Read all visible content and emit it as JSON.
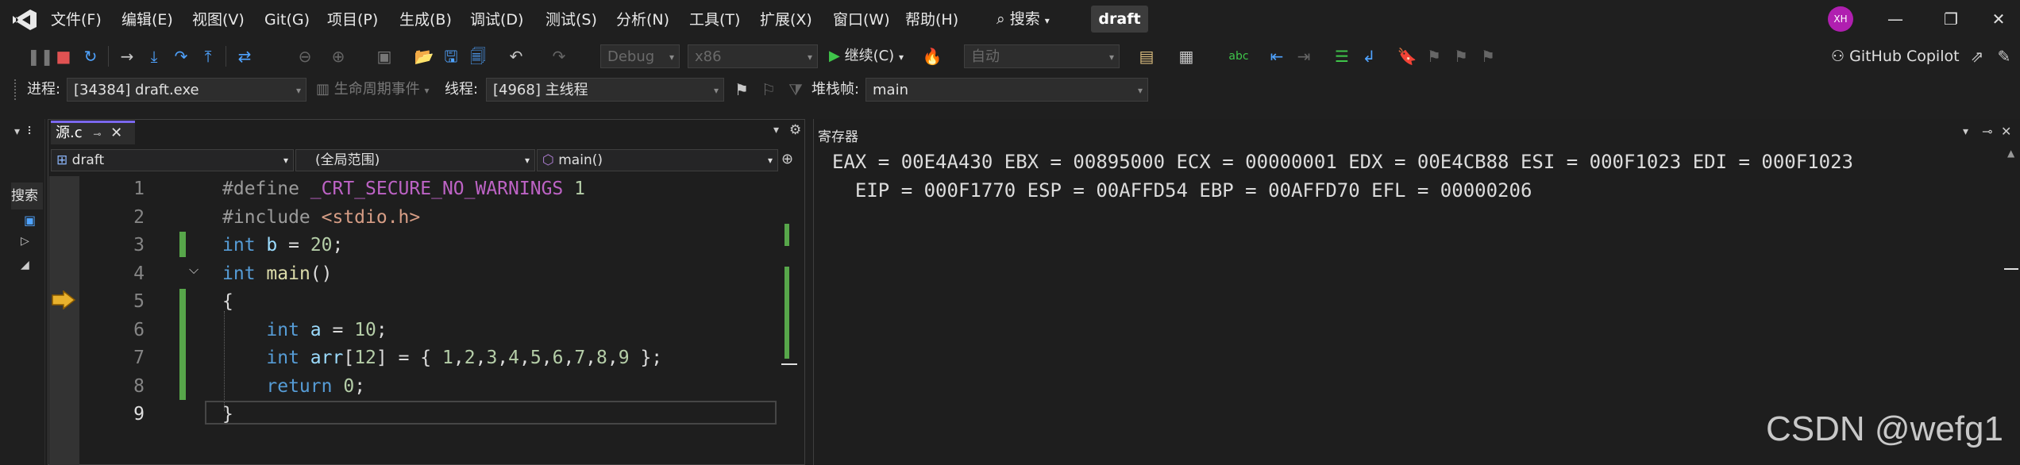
{
  "menu": [
    "文件(F)",
    "编辑(E)",
    "视图(V)",
    "Git(G)",
    "项目(P)",
    "生成(B)",
    "调试(D)",
    "测试(S)",
    "分析(N)",
    "工具(T)",
    "扩展(X)",
    "窗口(W)",
    "帮助(H)"
  ],
  "search_label": "搜索",
  "solution_name": "draft",
  "user_initials": "XH",
  "toolbar": {
    "config": "Debug",
    "platform": "x86",
    "continue_label": "继续(C)",
    "auto_label": "自动",
    "copilot_label": "GitHub Copilot"
  },
  "debug_location": {
    "process_label": "进程:",
    "process_value": "[34384] draft.exe",
    "lifecycle_label": "生命周期事件",
    "thread_label": "线程:",
    "thread_value": "[4968] 主线程",
    "stack_label": "堆栈帧:",
    "stack_value": "main"
  },
  "left_strip": {
    "search_label": "搜索"
  },
  "editor": {
    "tab_label": "源.c",
    "nav_project": "draft",
    "nav_scope": "(全局范围)",
    "nav_member": "main()",
    "lines": [
      {
        "n": "1",
        "parts": [
          [
            "pp",
            "#define "
          ],
          [
            "mac",
            "_CRT_SECURE_NO_WARNINGS"
          ],
          [
            "num",
            " 1"
          ]
        ]
      },
      {
        "n": "2",
        "parts": [
          [
            "pp",
            "#include "
          ],
          [
            "str",
            "<stdio.h>"
          ]
        ]
      },
      {
        "n": "3",
        "parts": [
          [
            "kw",
            "int"
          ],
          [
            "t",
            " "
          ],
          [
            "id",
            "b"
          ],
          [
            "t",
            " = "
          ],
          [
            "num",
            "20"
          ],
          [
            "t",
            ";"
          ]
        ]
      },
      {
        "n": "4",
        "parts": [
          [
            "kw",
            "int"
          ],
          [
            "t",
            " "
          ],
          [
            "fn",
            "main"
          ],
          [
            "t",
            "()"
          ]
        ]
      },
      {
        "n": "5",
        "parts": [
          [
            "t",
            "{"
          ]
        ]
      },
      {
        "n": "6",
        "parts": [
          [
            "t",
            "    "
          ],
          [
            "kw",
            "int"
          ],
          [
            "t",
            " "
          ],
          [
            "id",
            "a"
          ],
          [
            "t",
            " = "
          ],
          [
            "num",
            "10"
          ],
          [
            "t",
            ";"
          ]
        ]
      },
      {
        "n": "7",
        "parts": [
          [
            "t",
            "    "
          ],
          [
            "kw",
            "int"
          ],
          [
            "t",
            " "
          ],
          [
            "id",
            "arr"
          ],
          [
            "t",
            "["
          ],
          [
            "num",
            "12"
          ],
          [
            "t",
            "] = { "
          ],
          [
            "num",
            "1"
          ],
          [
            "t",
            ","
          ],
          [
            "num",
            "2"
          ],
          [
            "t",
            ","
          ],
          [
            "num",
            "3"
          ],
          [
            "t",
            ","
          ],
          [
            "num",
            "4"
          ],
          [
            "t",
            ","
          ],
          [
            "num",
            "5"
          ],
          [
            "t",
            ","
          ],
          [
            "num",
            "6"
          ],
          [
            "t",
            ","
          ],
          [
            "num",
            "7"
          ],
          [
            "t",
            ","
          ],
          [
            "num",
            "8"
          ],
          [
            "t",
            ","
          ],
          [
            "num",
            "9"
          ],
          [
            "t",
            " };"
          ]
        ]
      },
      {
        "n": "8",
        "parts": [
          [
            "t",
            "    "
          ],
          [
            "kw",
            "return"
          ],
          [
            "t",
            " "
          ],
          [
            "num",
            "0"
          ],
          [
            "t",
            ";"
          ]
        ]
      },
      {
        "n": "9",
        "parts": [
          [
            "t",
            "}"
          ]
        ]
      }
    ]
  },
  "registers": {
    "title": "寄存器",
    "line1": "EAX = 00E4A430 EBX = 00895000 ECX = 00000001 EDX = 00E4CB88 ESI = 000F1023 EDI = 000F1023",
    "line2": "  EIP = 000F1770 ESP = 00AFFD54 EBP = 00AFFD70 EFL = 00000206"
  },
  "watermark": "CSDN @wefg1"
}
